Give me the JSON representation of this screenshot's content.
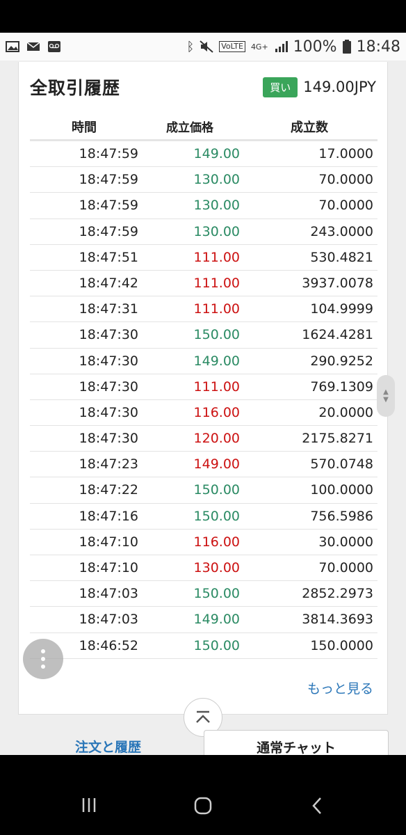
{
  "statusbar": {
    "network": "4G+",
    "volte": "VoLTE",
    "battery": "100%",
    "time": "18:48"
  },
  "card": {
    "title": "全取引履歴",
    "badge": "買い",
    "price": "149.00JPY"
  },
  "table": {
    "headers": {
      "time": "時間",
      "price": "成立価格",
      "qty": "成立数"
    },
    "rows": [
      {
        "time": "18:47:59",
        "price": "149.00",
        "qty": "17.0000",
        "dir": "up"
      },
      {
        "time": "18:47:59",
        "price": "130.00",
        "qty": "70.0000",
        "dir": "up"
      },
      {
        "time": "18:47:59",
        "price": "130.00",
        "qty": "70.0000",
        "dir": "up"
      },
      {
        "time": "18:47:59",
        "price": "130.00",
        "qty": "243.0000",
        "dir": "up"
      },
      {
        "time": "18:47:51",
        "price": "111.00",
        "qty": "530.4821",
        "dir": "down"
      },
      {
        "time": "18:47:42",
        "price": "111.00",
        "qty": "3937.0078",
        "dir": "down"
      },
      {
        "time": "18:47:31",
        "price": "111.00",
        "qty": "104.9999",
        "dir": "down"
      },
      {
        "time": "18:47:30",
        "price": "150.00",
        "qty": "1624.4281",
        "dir": "up"
      },
      {
        "time": "18:47:30",
        "price": "149.00",
        "qty": "290.9252",
        "dir": "up"
      },
      {
        "time": "18:47:30",
        "price": "111.00",
        "qty": "769.1309",
        "dir": "down"
      },
      {
        "time": "18:47:30",
        "price": "116.00",
        "qty": "20.0000",
        "dir": "down"
      },
      {
        "time": "18:47:30",
        "price": "120.00",
        "qty": "2175.8271",
        "dir": "down"
      },
      {
        "time": "18:47:23",
        "price": "149.00",
        "qty": "570.0748",
        "dir": "down"
      },
      {
        "time": "18:47:22",
        "price": "150.00",
        "qty": "100.0000",
        "dir": "up"
      },
      {
        "time": "18:47:16",
        "price": "150.00",
        "qty": "756.5986",
        "dir": "up"
      },
      {
        "time": "18:47:10",
        "price": "116.00",
        "qty": "30.0000",
        "dir": "down"
      },
      {
        "time": "18:47:10",
        "price": "130.00",
        "qty": "70.0000",
        "dir": "down"
      },
      {
        "time": "18:47:03",
        "price": "150.00",
        "qty": "2852.2973",
        "dir": "up"
      },
      {
        "time": "18:47:03",
        "price": "149.00",
        "qty": "3814.3693",
        "dir": "up"
      },
      {
        "time": "18:46:52",
        "price": "150.00",
        "qty": "150.0000",
        "dir": "up"
      }
    ],
    "more_link": "もっと見る"
  },
  "tabs": {
    "left": "注文と履歴",
    "right": "通常チャット"
  },
  "colors": {
    "up": "#2a8a63",
    "down": "#cc1111",
    "badge": "#3aa55a",
    "link": "#2a76b8"
  }
}
